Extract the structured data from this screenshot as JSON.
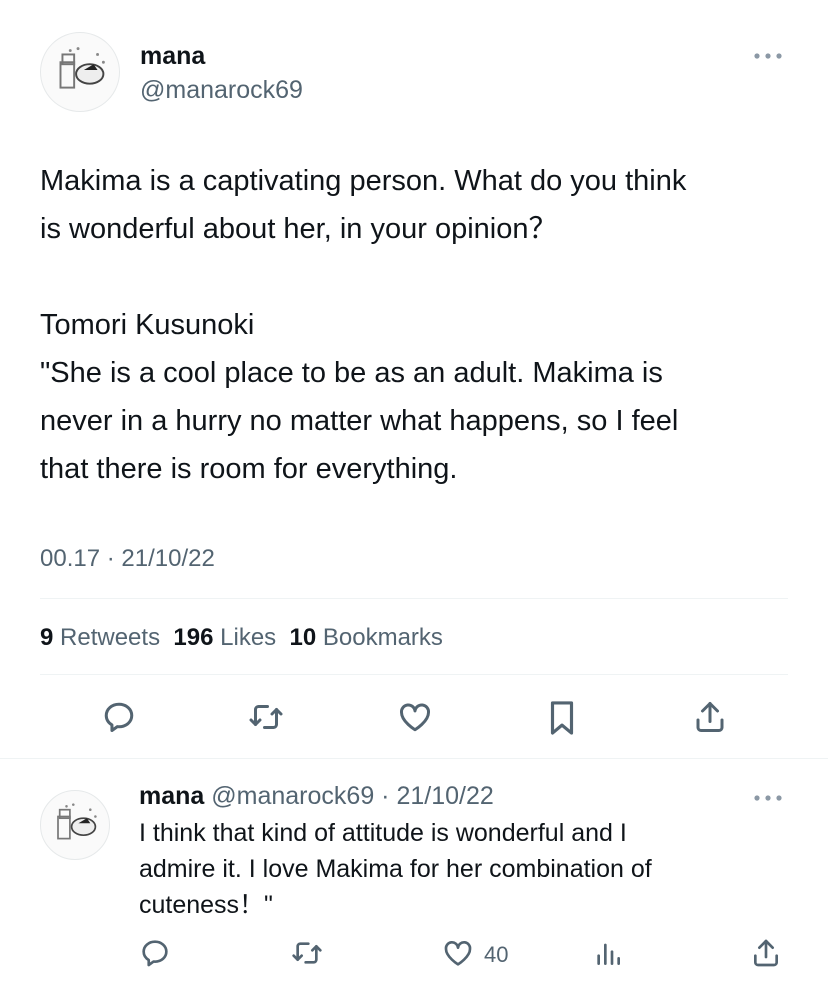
{
  "tweet": {
    "author_name": "mana",
    "author_handle": "@manarock69",
    "text": "Makima is a captivating person. What do you think\nis wonderful about her, in your opinion？\n\nTomori Kusunoki\n\"She is a cool place to be as an adult. Makima is\nnever in a hurry no matter what happens, so I feel\nthat there is room for everything.",
    "timestamp": "00.17 · 21/10/22",
    "stats": {
      "retweets_count": "9",
      "retweets_label": "Retweets",
      "likes_count": "196",
      "likes_label": "Likes",
      "bookmarks_count": "10",
      "bookmarks_label": "Bookmarks"
    }
  },
  "reply": {
    "author_name": "mana",
    "author_handle": "@manarock69",
    "date": "· 21/10/22",
    "text": "I think that kind of attitude is wonderful and I\nadmire it. I love Makima for her combination of\ncuteness！\"",
    "like_count": "40"
  },
  "icons": [
    "reply-icon",
    "retweet-icon",
    "like-icon",
    "bookmark-icon",
    "share-icon",
    "views-icon",
    "more-icon"
  ],
  "colors": {
    "text": "#0f1419",
    "secondary": "#536471",
    "divider": "#eff3f4"
  }
}
